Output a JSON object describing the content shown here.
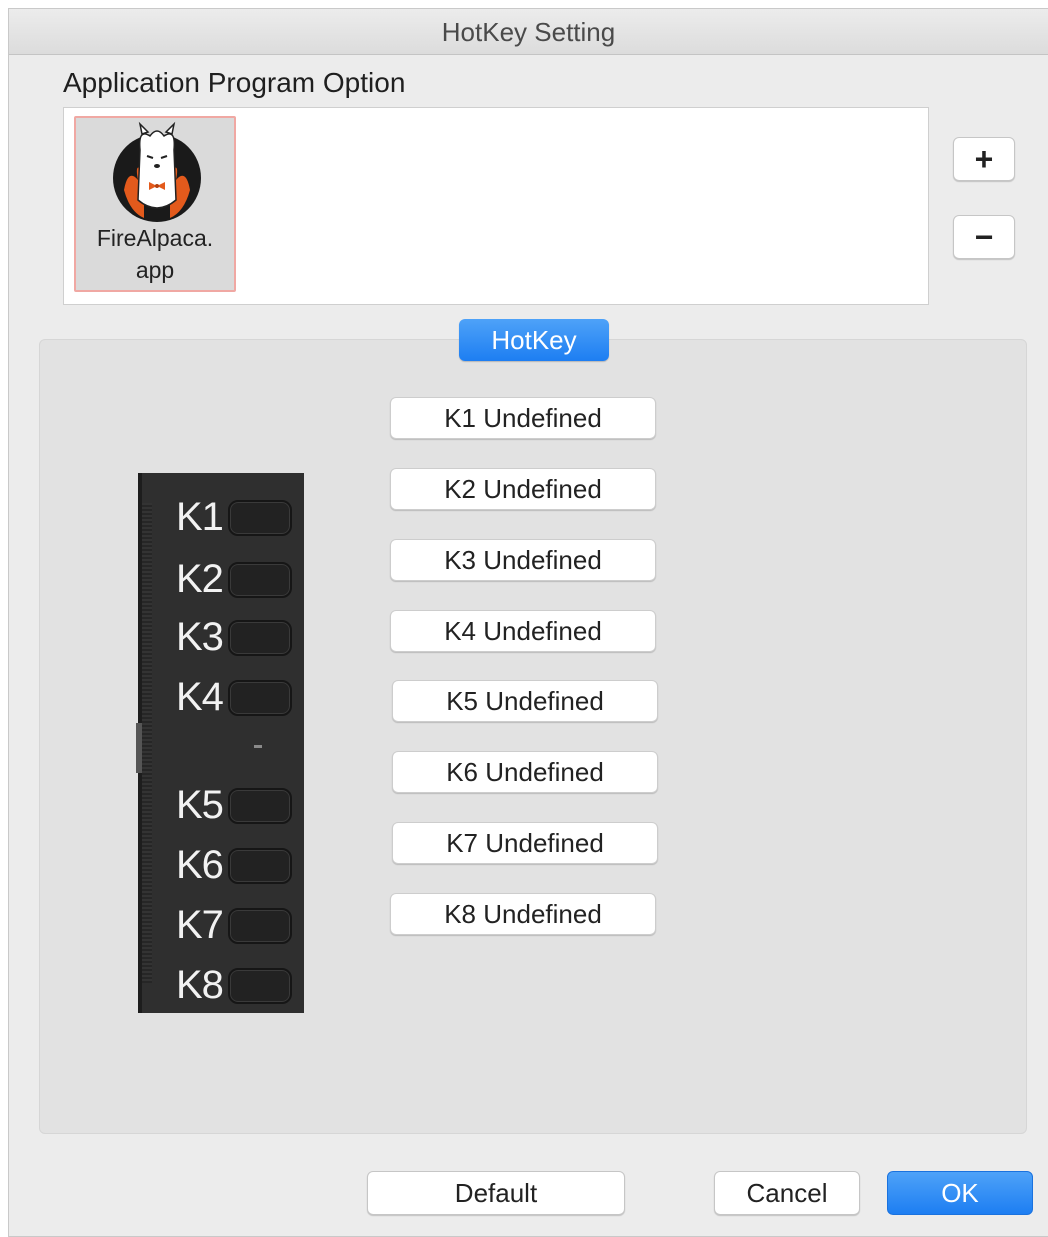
{
  "window": {
    "title": "HotKey Setting"
  },
  "app_options": {
    "section_title": "Application Program Option",
    "items": [
      {
        "name": "FireAlpaca.\napp",
        "icon": "alpaca-logo-icon"
      }
    ],
    "add_label": "+",
    "remove_label": "−"
  },
  "tab": {
    "label": "HotKey"
  },
  "device": {
    "keys": [
      "K1",
      "K2",
      "K3",
      "K4",
      "K5",
      "K6",
      "K7",
      "K8"
    ]
  },
  "hotkeys": [
    {
      "label": "K1 Undefined"
    },
    {
      "label": "K2 Undefined"
    },
    {
      "label": "K3 Undefined"
    },
    {
      "label": "K4 Undefined"
    },
    {
      "label": "K5 Undefined"
    },
    {
      "label": "K6 Undefined"
    },
    {
      "label": "K7 Undefined"
    },
    {
      "label": "K8 Undefined"
    }
  ],
  "footer": {
    "default_label": "Default",
    "cancel_label": "Cancel",
    "ok_label": "OK"
  },
  "colors": {
    "accent": "#1d7ef2",
    "selection_border": "#f0a8a3",
    "panel": "#e2e2e2"
  }
}
